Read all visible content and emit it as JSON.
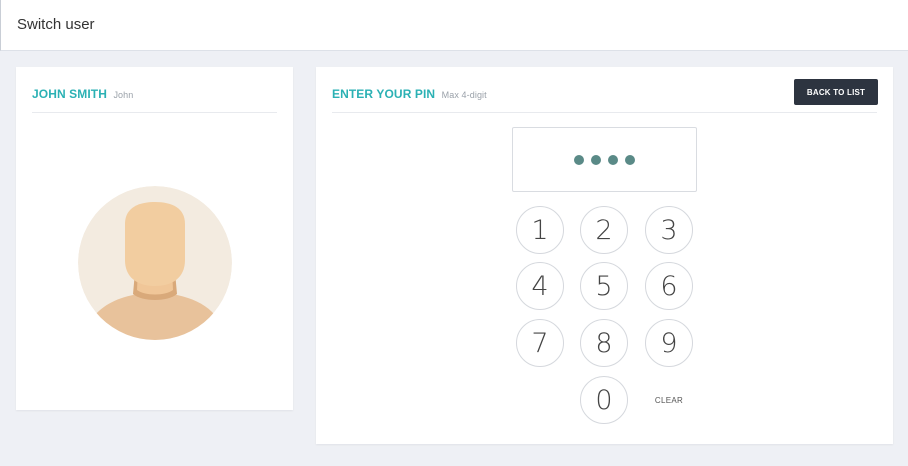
{
  "header": {
    "title": "Switch user"
  },
  "user_card": {
    "name": "JOHN SMITH",
    "nickname": "John",
    "avatar_icon": "user-avatar-icon",
    "colors": {
      "avatar_bg": "#f3ebe0",
      "skin": "#f2cda0",
      "shirt": "#e8c29b",
      "neck_shadow": "#d9a97a"
    }
  },
  "pin_card": {
    "title": "ENTER YOUR PIN",
    "subtitle": "Max 4-digit",
    "back_button": "BACK TO LIST",
    "pin_dots": 4,
    "keys": [
      "1",
      "2",
      "3",
      "4",
      "5",
      "6",
      "7",
      "8",
      "9",
      "0"
    ],
    "clear_label": "CLEAR"
  },
  "colors": {
    "accent": "#2bb1b4",
    "button_dark": "#2d3440",
    "page_bg": "#eef0f5",
    "pin_dot": "#5a8a87"
  }
}
